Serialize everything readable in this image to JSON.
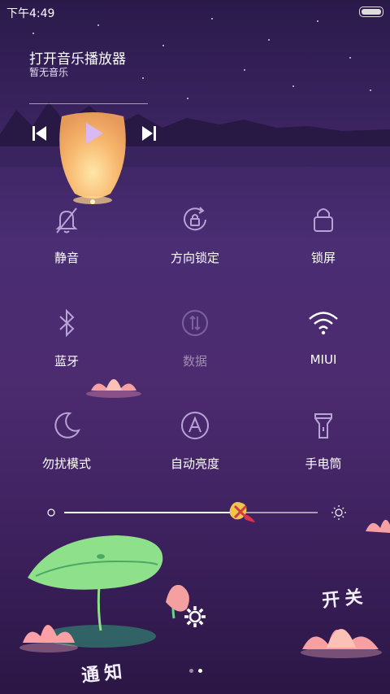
{
  "status": {
    "time": "下午4:49"
  },
  "music": {
    "title": "打开音乐播放器",
    "subtitle": "暂无音乐"
  },
  "toggles": [
    {
      "label": "静音",
      "icon": "bell-off-icon",
      "active": false
    },
    {
      "label": "方向锁定",
      "icon": "rotation-lock-icon",
      "active": false
    },
    {
      "label": "锁屏",
      "icon": "lock-icon",
      "active": false
    },
    {
      "label": "蓝牙",
      "icon": "bluetooth-icon",
      "active": false
    },
    {
      "label": "数据",
      "icon": "data-icon",
      "active": false,
      "disabled": true
    },
    {
      "label": "MIUI",
      "icon": "wifi-icon",
      "active": true
    },
    {
      "label": "勿扰模式",
      "icon": "moon-icon",
      "active": false
    },
    {
      "label": "自动亮度",
      "icon": "auto-brightness-icon",
      "active": false
    },
    {
      "label": "手电筒",
      "icon": "flashlight-icon",
      "active": false
    }
  ],
  "brightness": {
    "level": 0.7
  },
  "decor": {
    "notify_text": "通知",
    "switch_text": "开关"
  },
  "pager": {
    "pages": 2,
    "current": 2
  },
  "colors": {
    "accent": "#d9b8f5",
    "bg_top": "#2a1a4a",
    "bg_bottom": "#2b1645"
  }
}
